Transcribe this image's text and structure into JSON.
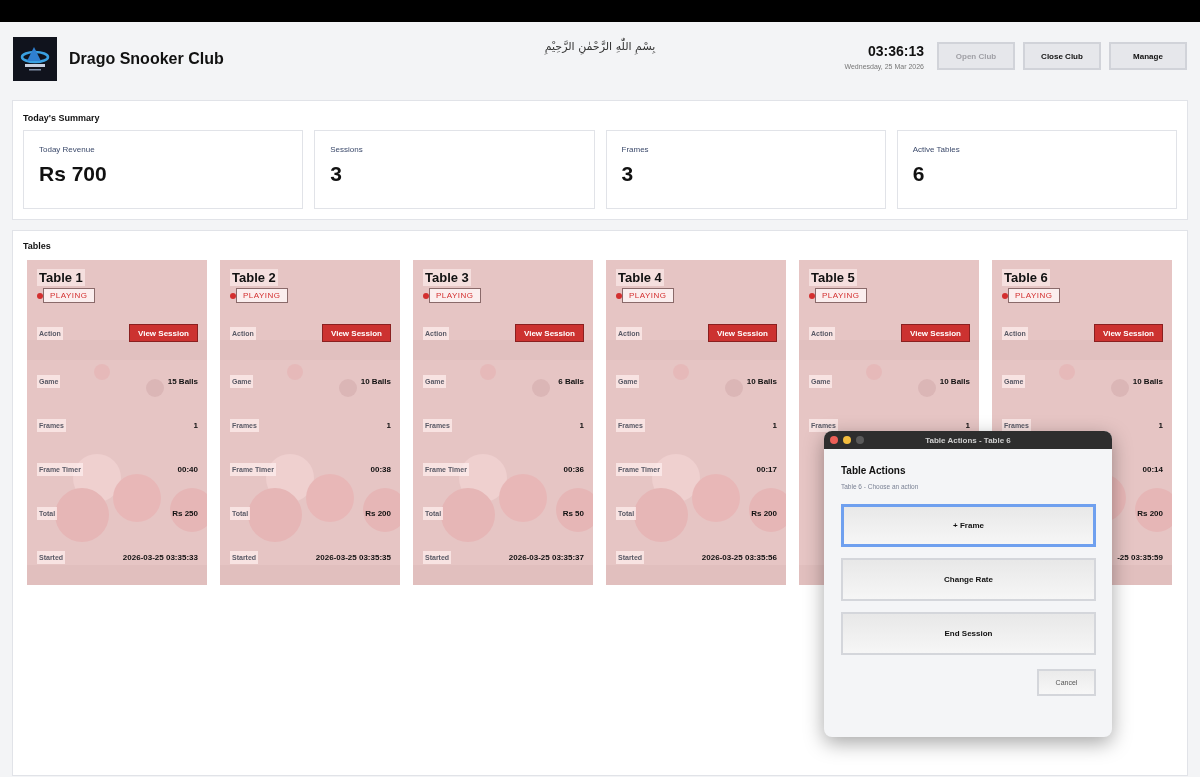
{
  "header": {
    "title": "Drago Snooker Club",
    "bismillah": "بِسْمِ اللّٰهِ الرَّحْمٰنِ الرَّحِيْمِ",
    "time": "03:36:13",
    "date": "Wednesday, 25 Mar 2026",
    "buttons": [
      {
        "label": "Open Club",
        "disabled": true
      },
      {
        "label": "Close Club",
        "disabled": false
      },
      {
        "label": "Manage",
        "disabled": false
      }
    ]
  },
  "summary": {
    "title": "Today's Summary",
    "cards": [
      {
        "label": "Today Revenue",
        "value": "Rs 700"
      },
      {
        "label": "Sessions",
        "value": "3"
      },
      {
        "label": "Frames",
        "value": "3"
      },
      {
        "label": "Active Tables",
        "value": "6"
      }
    ]
  },
  "tables": {
    "title": "Tables",
    "items": [
      {
        "name": "Table 1",
        "status": "PLAYING",
        "color": "#d32f2f",
        "action_label": "Action",
        "action": "View Session",
        "rows": [
          {
            "label": "Game",
            "value": "15 Balls"
          },
          {
            "label": "Frames",
            "value": "1"
          },
          {
            "label": "Frame Timer",
            "value": "00:40"
          },
          {
            "label": "Total",
            "value": "Rs 250"
          },
          {
            "label": "Started",
            "value": "2026-03-25 03:35:33"
          }
        ]
      },
      {
        "name": "Table 2",
        "status": "PLAYING",
        "color": "#d32f2f",
        "action_label": "Action",
        "action": "View Session",
        "rows": [
          {
            "label": "Game",
            "value": "10 Balls"
          },
          {
            "label": "Frames",
            "value": "1"
          },
          {
            "label": "Frame Timer",
            "value": "00:38"
          },
          {
            "label": "Total",
            "value": "Rs 200"
          },
          {
            "label": "Started",
            "value": "2026-03-25 03:35:35"
          }
        ]
      },
      {
        "name": "Table 3",
        "status": "PLAYING",
        "color": "#d32f2f",
        "action_label": "Action",
        "action": "View Session",
        "rows": [
          {
            "label": "Game",
            "value": "6 Balls"
          },
          {
            "label": "Frames",
            "value": "1"
          },
          {
            "label": "Frame Timer",
            "value": "00:36"
          },
          {
            "label": "Total",
            "value": "Rs 50"
          },
          {
            "label": "Started",
            "value": "2026-03-25 03:35:37"
          }
        ]
      },
      {
        "name": "Table 4",
        "status": "PLAYING",
        "color": "#d32f2f",
        "action_label": "Action",
        "action": "View Session",
        "rows": [
          {
            "label": "Game",
            "value": "10 Balls"
          },
          {
            "label": "Frames",
            "value": "1"
          },
          {
            "label": "Frame Timer",
            "value": "00:17"
          },
          {
            "label": "Total",
            "value": "Rs 200"
          },
          {
            "label": "Started",
            "value": "2026-03-25 03:35:56"
          }
        ]
      },
      {
        "name": "Table 5",
        "status": "PLAYING",
        "color": "#d32f2f",
        "action_label": "Action",
        "action": "View Session",
        "rows": [
          {
            "label": "Game",
            "value": "10 Balls"
          },
          {
            "label": "Frames",
            "value": "1"
          }
        ]
      },
      {
        "name": "Table 6",
        "status": "PLAYING",
        "color": "#d32f2f",
        "action_label": "Action",
        "action": "View Session",
        "rows": [
          {
            "label": "Game",
            "value": "10 Balls"
          },
          {
            "label": "Frames",
            "value": "1"
          },
          {
            "value": "00:14"
          },
          {
            "value": "Rs 200"
          },
          {
            "value": "-25 03:35:59"
          }
        ]
      }
    ]
  },
  "dialog": {
    "window_title": "Table Actions - Table 6",
    "title": "Table Actions",
    "subtitle": "Table 6 - Choose an action",
    "actions": [
      {
        "label": "+ Frame",
        "focused": true
      },
      {
        "label": "Change Rate",
        "focused": false
      },
      {
        "label": "End Session",
        "focused": false
      }
    ],
    "cancel": "Cancel"
  }
}
